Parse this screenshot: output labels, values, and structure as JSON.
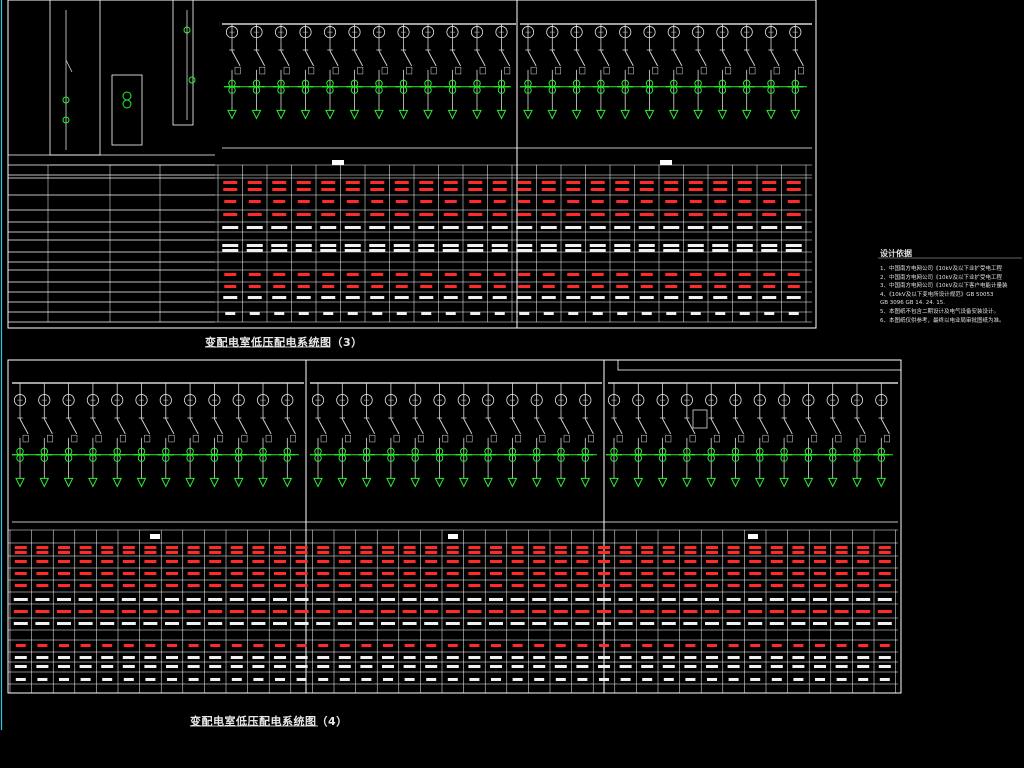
{
  "drawing": {
    "colors": {
      "background": "#000000",
      "frame_line": "#ffffff",
      "breaker_line": "#dcdcdc",
      "ct_symbol": "#26f02d",
      "load_arrow": "#26f02d",
      "text_red": "#ff2a2a",
      "text_white": "#f0f0f0",
      "border_cyan": "#2ec8e6"
    },
    "sheet1_title": "变配电室低压配电系统图（3）",
    "sheet2_title": "变配电室低压配电系统图（4）",
    "notes": {
      "heading": "设计依据",
      "items": [
        "1、中国南方电网公司《10kV及以下业扩受电工程",
        "2、中国南方电网公司《10kV及以下业扩受电工程",
        "3、中国南方电网公司《10kV及以下客户电能计量装",
        "4、《10kV及以下变电所设计规范》GB 50053",
        "GB 3096  GB 14.  24.  15.",
        "5、本图纸不包含二期设计及电气设备安装设计。",
        "6、本图纸仅供参考，最终以电业局审批图纸为准。"
      ]
    }
  }
}
